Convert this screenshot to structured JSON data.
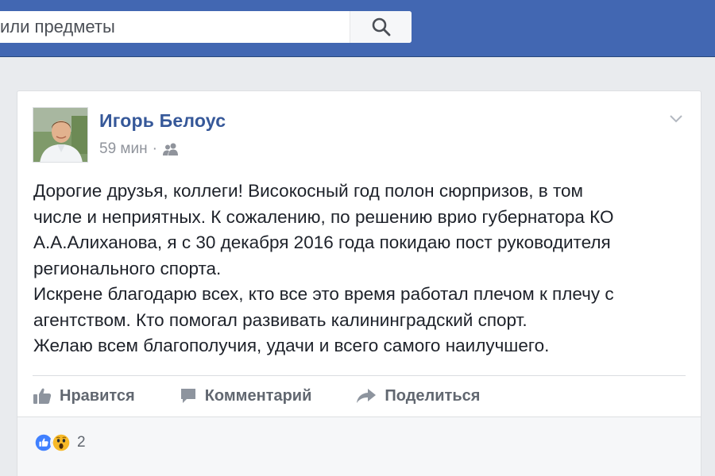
{
  "search": {
    "placeholder": "или предметы"
  },
  "post": {
    "author": "Игорь Белоус",
    "time": "59 мин",
    "separator": "·",
    "text_lines": [
      "Дорогие друзья, коллеги! Високосный год полон сюрпризов, в том",
      "числе и неприятных. К сожалению, по решению врио губернатора КО",
      "А.А.Алиханова, я с 30 декабря 2016 года покидаю пост руководителя",
      "регионального спорта.",
      "Искрене благодарю всех, кто все это время работал плечом к плечу с",
      "агентством. Кто помогал развивать калининградский спорт.",
      "Желаю всем благополучия, удачи и всего самого наилучшего."
    ]
  },
  "actions": {
    "like": "Нравится",
    "comment": "Комментарий",
    "share": "Поделиться"
  },
  "reactions": {
    "count": "2",
    "types": [
      "like-reaction-icon",
      "wow-reaction-icon"
    ]
  },
  "colors": {
    "header": "#4267b2",
    "author_link": "#365899",
    "text": "#1d2129",
    "muted": "#90949c",
    "action": "#616770",
    "like_blue": "#4080ff",
    "wow_yellow": "#f7b928"
  },
  "icons": {
    "search": "search-icon",
    "audience": "friends-icon",
    "menu": "chevron-down-icon",
    "like": "thumbs-up-icon",
    "comment": "comment-icon",
    "share": "share-arrow-icon"
  }
}
